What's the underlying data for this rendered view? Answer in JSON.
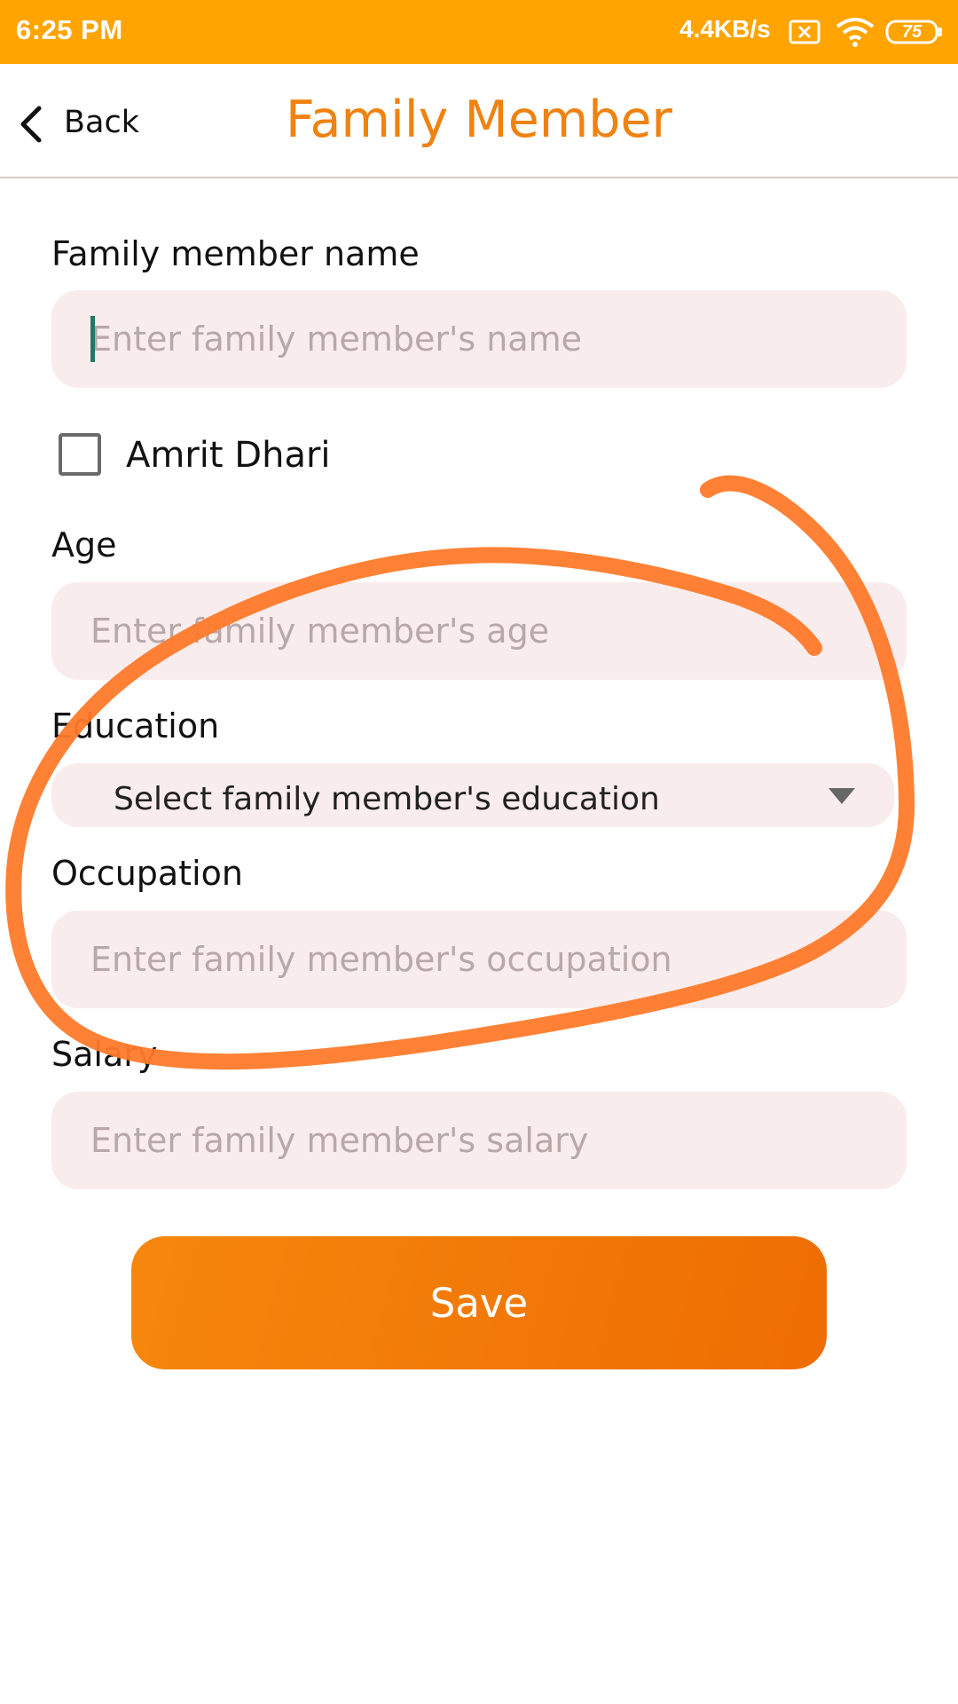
{
  "status_bar": {
    "time": "6:25 PM",
    "network_speed": "4.4KB/s",
    "battery_level": "75",
    "icons": [
      "sim-x-icon",
      "wifi-icon",
      "battery-icon"
    ]
  },
  "header": {
    "back_label": "Back",
    "title": "Family Member"
  },
  "form": {
    "name": {
      "label": "Family member name",
      "placeholder": "Enter family member's name"
    },
    "amrit_dhari": {
      "label": "Amrit Dhari",
      "checked": false
    },
    "age": {
      "label": "Age",
      "placeholder": "Enter family member's age"
    },
    "education": {
      "label": "Education",
      "selected": "Select family member's education"
    },
    "occupation": {
      "label": "Occupation",
      "placeholder": "Enter family member's occupation"
    },
    "salary": {
      "label": "Salary",
      "placeholder": "Enter family member's salary"
    },
    "save_label": "Save"
  },
  "colors": {
    "status_bar": "#FFA400",
    "title": "#EF8210",
    "field_bg": "#F9ECEC",
    "button": "#F07A08",
    "annotation_stroke": "#FF7A2A"
  }
}
